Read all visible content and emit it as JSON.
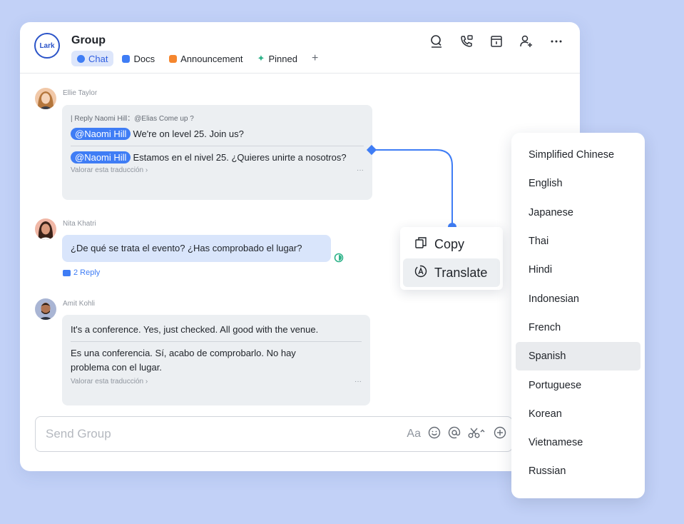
{
  "header": {
    "logo": "Lark",
    "title": "Group",
    "tabs": [
      {
        "label": "Chat",
        "color": "#3f7df5"
      },
      {
        "label": "Docs",
        "color": "#3f7df5"
      },
      {
        "label": "Announcement",
        "color": "#f5862e"
      },
      {
        "label": "Pinned",
        "color": "#2fb38a"
      }
    ],
    "add_tab": "+",
    "icons": [
      "search-icon",
      "call-icon",
      "calendar-icon",
      "add-member-icon",
      "more-icon"
    ]
  },
  "messages": [
    {
      "sender": "Ellie Taylor",
      "reply": "| Reply Naomi Hill：@Elias Come up ?",
      "mention": "@Naomi Hill",
      "text": "We're on level 25. Join us?",
      "translation_mention": "@Naomi Hill",
      "translation": "Estamos en el nivel 25. ¿Quieres unirte a nosotros?",
      "rate": "Valorar esta traducción",
      "more": "···"
    },
    {
      "sender": "Nita Khatri",
      "text": "¿De qué se trata el evento? ¿Has comprobado el lugar?",
      "replies": "2 Reply"
    },
    {
      "sender": "Amit Kohli",
      "text": "It's a conference. Yes, just checked. All good with the venue.",
      "translation": "Es una conferencia. Sí, acabo de comprobarlo. No hay problema con el lugar.",
      "rate": "Valorar esta traducción",
      "more": "···"
    }
  ],
  "input": {
    "placeholder": "Send Group",
    "format_label": "Aa"
  },
  "context_menu": {
    "items": [
      "Copy",
      "Translate"
    ]
  },
  "languages": {
    "items": [
      "Simplified Chinese",
      "English",
      "Japanese",
      "Thai",
      "Hindi",
      "Indonesian",
      "French",
      "Spanish",
      "Portuguese",
      "Korean",
      "Vietnamese",
      "Russian"
    ],
    "selected": "Spanish"
  },
  "colors": {
    "accent": "#3f7df5",
    "background": "#c2d1f7",
    "bubble": "#eceff2"
  }
}
